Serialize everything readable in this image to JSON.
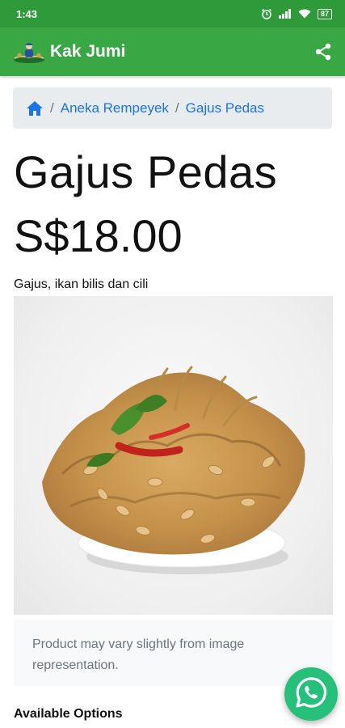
{
  "status_bar": {
    "time": "1:43",
    "battery": "87"
  },
  "app_bar": {
    "title": "Kak Jumi"
  },
  "breadcrumb": {
    "items": [
      "Aneka Rempeyek",
      "Gajus Pedas"
    ]
  },
  "product": {
    "name": "Gajus Pedas",
    "price": "S$18.00",
    "description": "Gajus, ikan bilis dan cili",
    "image_note": "Product may vary slightly from image representation."
  },
  "options": {
    "heading": "Available Options"
  },
  "colors": {
    "status_bar": "#2f9a3a",
    "app_bar": "#3aa745",
    "link": "#1a73e8",
    "whatsapp": "#26c07a"
  },
  "icons": {
    "status": [
      "alarm-icon",
      "signal-icon",
      "wifi-icon",
      "battery-icon"
    ],
    "app_bar": [
      "logo-icon",
      "share-icon"
    ],
    "breadcrumb": "home-icon",
    "fab": "whatsapp-icon"
  }
}
